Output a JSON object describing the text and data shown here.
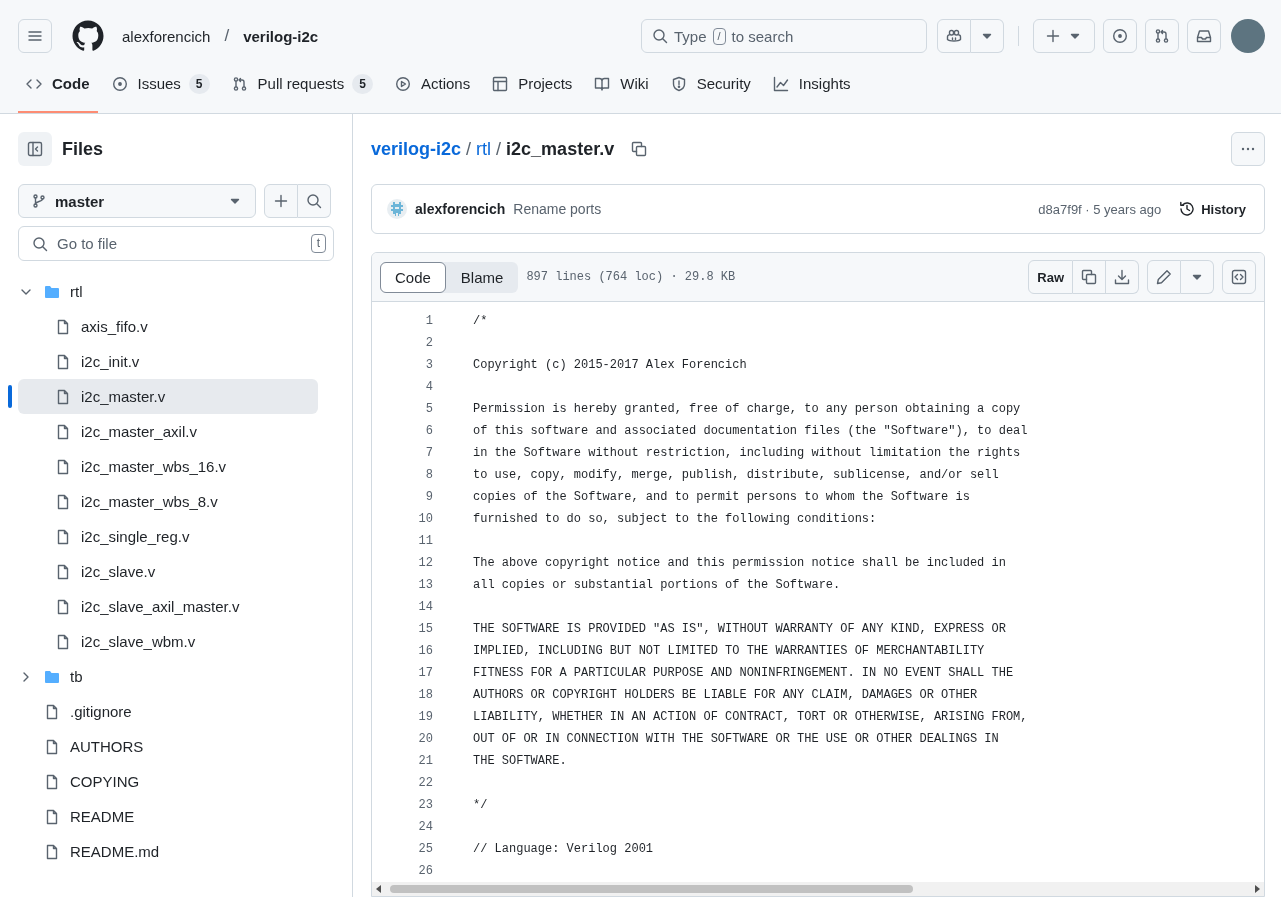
{
  "header": {
    "owner": "alexforencich",
    "separator": "/",
    "repo": "verilog-i2c",
    "search": {
      "before": "Type",
      "key": "/",
      "after": "to search"
    }
  },
  "nav_tabs": [
    {
      "kind": "code",
      "label": "Code",
      "selected": true
    },
    {
      "kind": "issue",
      "label": "Issues",
      "count": "5",
      "selected": false
    },
    {
      "kind": "pr",
      "label": "Pull requests",
      "count": "5",
      "selected": false
    },
    {
      "kind": "play",
      "label": "Actions",
      "selected": false
    },
    {
      "kind": "table",
      "label": "Projects",
      "selected": false
    },
    {
      "kind": "book",
      "label": "Wiki",
      "selected": false
    },
    {
      "kind": "shield",
      "label": "Security",
      "selected": false
    },
    {
      "kind": "graph",
      "label": "Insights",
      "selected": false
    }
  ],
  "sidebar": {
    "title": "Files",
    "branch": "master",
    "file_search": {
      "placeholder": "Go to file",
      "shortcut": "t"
    },
    "tree": [
      {
        "kind": "folder",
        "name": "rtl",
        "expanded": true,
        "selected": false,
        "children": [
          {
            "kind": "file",
            "name": "axis_fifo.v",
            "selected": false
          },
          {
            "kind": "file",
            "name": "i2c_init.v",
            "selected": false
          },
          {
            "kind": "file",
            "name": "i2c_master.v",
            "selected": true
          },
          {
            "kind": "file",
            "name": "i2c_master_axil.v",
            "selected": false
          },
          {
            "kind": "file",
            "name": "i2c_master_wbs_16.v",
            "selected": false
          },
          {
            "kind": "file",
            "name": "i2c_master_wbs_8.v",
            "selected": false
          },
          {
            "kind": "file",
            "name": "i2c_single_reg.v",
            "selected": false
          },
          {
            "kind": "file",
            "name": "i2c_slave.v",
            "selected": false
          },
          {
            "kind": "file",
            "name": "i2c_slave_axil_master.v",
            "selected": false
          },
          {
            "kind": "file",
            "name": "i2c_slave_wbm.v",
            "selected": false
          }
        ]
      },
      {
        "kind": "folder",
        "name": "tb",
        "expanded": false,
        "selected": false
      },
      {
        "kind": "file",
        "name": ".gitignore",
        "selected": false
      },
      {
        "kind": "file",
        "name": "AUTHORS",
        "selected": false
      },
      {
        "kind": "file",
        "name": "COPYING",
        "selected": false
      },
      {
        "kind": "file",
        "name": "README",
        "selected": false
      },
      {
        "kind": "file",
        "name": "README.md",
        "selected": false
      }
    ]
  },
  "breadcrumb": {
    "parts": [
      "verilog-i2c",
      "rtl"
    ],
    "separator": "/",
    "file": "i2c_master.v"
  },
  "commit": {
    "author": "alexforencich",
    "message": "Rename ports",
    "meta": "d8a7f9f · 5 years ago",
    "history": "History"
  },
  "file_view": {
    "view_tabs": [
      {
        "label": "Code",
        "selected": true
      },
      {
        "label": "Blame",
        "selected": false
      }
    ],
    "info": "897 lines (764 loc) · 29.8 KB",
    "raw": "Raw",
    "lines": [
      {
        "number": "1",
        "text": "/*"
      },
      {
        "number": "2"
      },
      {
        "number": "3",
        "text": "Copyright (c) 2015-2017 Alex Forencich"
      },
      {
        "number": "4"
      },
      {
        "number": "5",
        "text": "Permission is hereby granted, free of charge, to any person obtaining a copy"
      },
      {
        "number": "6",
        "text": "of this software and associated documentation files (the \"Software\"), to deal"
      },
      {
        "number": "7",
        "text": "in the Software without restriction, including without limitation the rights"
      },
      {
        "number": "8",
        "text": "to use, copy, modify, merge, publish, distribute, sublicense, and/or sell"
      },
      {
        "number": "9",
        "text": "copies of the Software, and to permit persons to whom the Software is"
      },
      {
        "number": "10",
        "text": "furnished to do so, subject to the following conditions:"
      },
      {
        "number": "11"
      },
      {
        "number": "12",
        "text": "The above copyright notice and this permission notice shall be included in"
      },
      {
        "number": "13",
        "text": "all copies or substantial portions of the Software."
      },
      {
        "number": "14"
      },
      {
        "number": "15",
        "text": "THE SOFTWARE IS PROVIDED \"AS IS\", WITHOUT WARRANTY OF ANY KIND, EXPRESS OR"
      },
      {
        "number": "16",
        "text": "IMPLIED, INCLUDING BUT NOT LIMITED TO THE WARRANTIES OF MERCHANTABILITY"
      },
      {
        "number": "17",
        "text": "FITNESS FOR A PARTICULAR PURPOSE AND NONINFRINGEMENT. IN NO EVENT SHALL THE"
      },
      {
        "number": "18",
        "text": "AUTHORS OR COPYRIGHT HOLDERS BE LIABLE FOR ANY CLAIM, DAMAGES OR OTHER"
      },
      {
        "number": "19",
        "text": "LIABILITY, WHETHER IN AN ACTION OF CONTRACT, TORT OR OTHERWISE, ARISING FROM,"
      },
      {
        "number": "20",
        "text": "OUT OF OR IN CONNECTION WITH THE SOFTWARE OR THE USE OR OTHER DEALINGS IN"
      },
      {
        "number": "21",
        "text": "THE SOFTWARE."
      },
      {
        "number": "22"
      },
      {
        "number": "23",
        "text": "*/"
      },
      {
        "number": "24"
      },
      {
        "number": "25",
        "text": "// Language: Verilog 2001"
      },
      {
        "number": "26"
      }
    ]
  }
}
